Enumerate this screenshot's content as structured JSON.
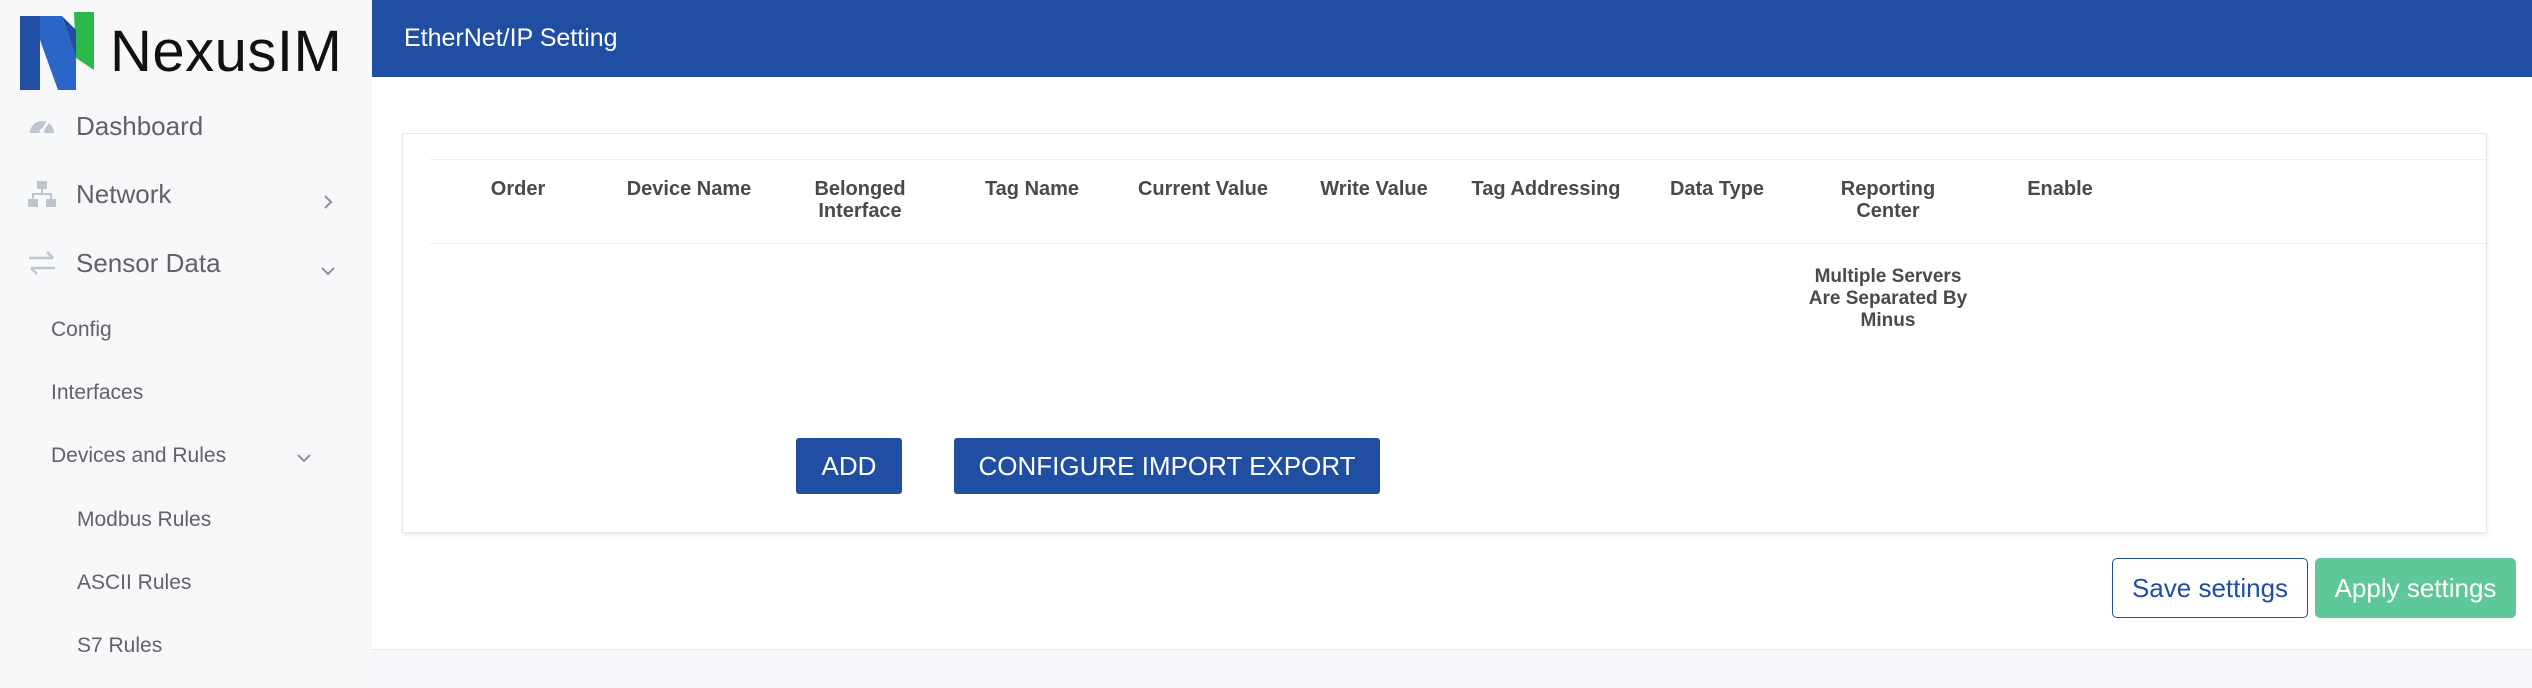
{
  "brand": {
    "name": "NexusIM",
    "logo_colors": [
      "#1f4ea3",
      "#2db84b"
    ]
  },
  "sidebar": {
    "items": [
      {
        "label": "Dashboard",
        "icon": "speedometer-icon"
      },
      {
        "label": "Network",
        "icon": "network-icon",
        "arrow": "chevron-right-icon"
      },
      {
        "label": "Sensor Data",
        "icon": "arrows-icon",
        "arrow": "chevron-down-icon"
      }
    ],
    "sensor_sub": [
      {
        "label": "Config"
      },
      {
        "label": "Interfaces"
      },
      {
        "label": "Devices and Rules",
        "arrow": "chevron-down-icon"
      }
    ],
    "rules_sub": [
      {
        "label": "Modbus Rules"
      },
      {
        "label": "ASCII Rules"
      },
      {
        "label": "S7 Rules"
      }
    ]
  },
  "header": {
    "title": "EtherNet/IP Setting",
    "color": "#1f4ea3"
  },
  "table": {
    "columns": [
      "Order",
      "Device Name",
      "Belonged Interface",
      "Tag Name",
      "Current Value",
      "Write Value",
      "Tag Addressing",
      "Data Type",
      "Reporting Center",
      "Enable"
    ],
    "reporting_center_note": "Multiple Servers Are Separated By Minus",
    "rows": []
  },
  "actions": {
    "add_label": "ADD",
    "config_label": "CONFIGURE IMPORT EXPORT",
    "save_label": "Save settings",
    "apply_label": "Apply settings",
    "apply_color": "#5fc898"
  }
}
